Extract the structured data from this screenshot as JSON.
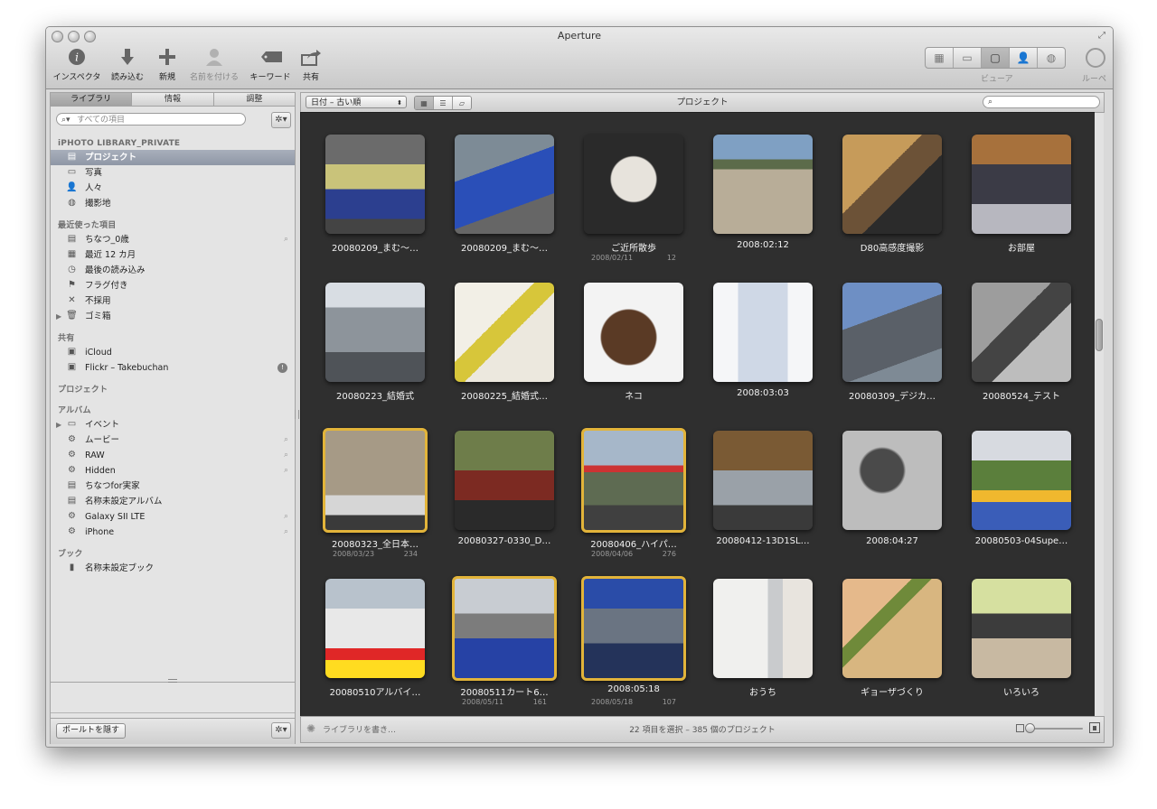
{
  "window": {
    "title": "Aperture"
  },
  "toolbar": {
    "inspector": "インスペクタ",
    "import": "読み込む",
    "new": "新規",
    "name_faces": "名前を付ける",
    "keywords": "キーワード",
    "share": "共有",
    "viewer": "ビューア",
    "loupe": "ルーペ"
  },
  "sidebar": {
    "tabs": [
      "ライブラリ",
      "情報",
      "調整"
    ],
    "search_placeholder": "すべての項目",
    "library_head": "iPHOTO LIBRARY_PRIVATE",
    "library_items": [
      "プロジェクト",
      "写真",
      "人々",
      "撮影地"
    ],
    "recent_head": "最近使った項目",
    "recent_items": [
      "ちなつ_0歳",
      "最近 12 カ月",
      "最後の読み込み",
      "フラグ付き",
      "不採用",
      "ゴミ箱"
    ],
    "shared_head": "共有",
    "shared_items": [
      "iCloud",
      "Flickr – Takebuchan"
    ],
    "projects_head": "プロジェクト",
    "albums_head": "アルバム",
    "album_items": [
      "イベント",
      "ムービー",
      "RAW",
      "Hidden",
      "ちなつfor実家",
      "名称未設定アルバム",
      "Galaxy SII LTE",
      "iPhone"
    ],
    "books_head": "ブック",
    "book_items": [
      "名称未設定ブック"
    ],
    "hide_button": "ポールトを隠す"
  },
  "browser": {
    "sort_label": "日付 – 古い順",
    "title": "プロジェクト",
    "status_left": "ライブラリを書き…",
    "status_center": "22 項目を選択 – 385 個のプロジェクト",
    "tiles": [
      {
        "name": "20080209_まむ～…"
      },
      {
        "name": "20080209_まむ～…"
      },
      {
        "name": "ご近所散歩",
        "date": "2008/02/11",
        "count": "12"
      },
      {
        "name": "2008:02:12"
      },
      {
        "name": "D80高感度撮影"
      },
      {
        "name": "お部屋"
      },
      {
        "name": "20080223_結婚式"
      },
      {
        "name": "20080225_結婚式…"
      },
      {
        "name": "ネコ"
      },
      {
        "name": "2008:03:03"
      },
      {
        "name": "20080309_デジカ…"
      },
      {
        "name": "20080524_テスト"
      },
      {
        "name": "20080323_全日本…",
        "date": "2008/03/23",
        "count": "234"
      },
      {
        "name": "20080327-0330_D…"
      },
      {
        "name": "20080406_ハイパ…",
        "date": "2008/04/06",
        "count": "276"
      },
      {
        "name": "20080412-13D1SL…"
      },
      {
        "name": "2008:04:27"
      },
      {
        "name": "20080503-04Supe…"
      },
      {
        "name": "20080510アルバイ…"
      },
      {
        "name": "20080511カート6…",
        "date": "2008/05/11",
        "count": "161"
      },
      {
        "name": "2008:05:18",
        "date": "2008/05/18",
        "count": "107"
      },
      {
        "name": "おうち"
      },
      {
        "name": "ギョーザづくり"
      },
      {
        "name": "いろいろ"
      }
    ]
  },
  "colors": {
    "stack_border": "#e2b43a",
    "selection": "#8f97a6",
    "browser_bg": "#2f2f2f"
  }
}
